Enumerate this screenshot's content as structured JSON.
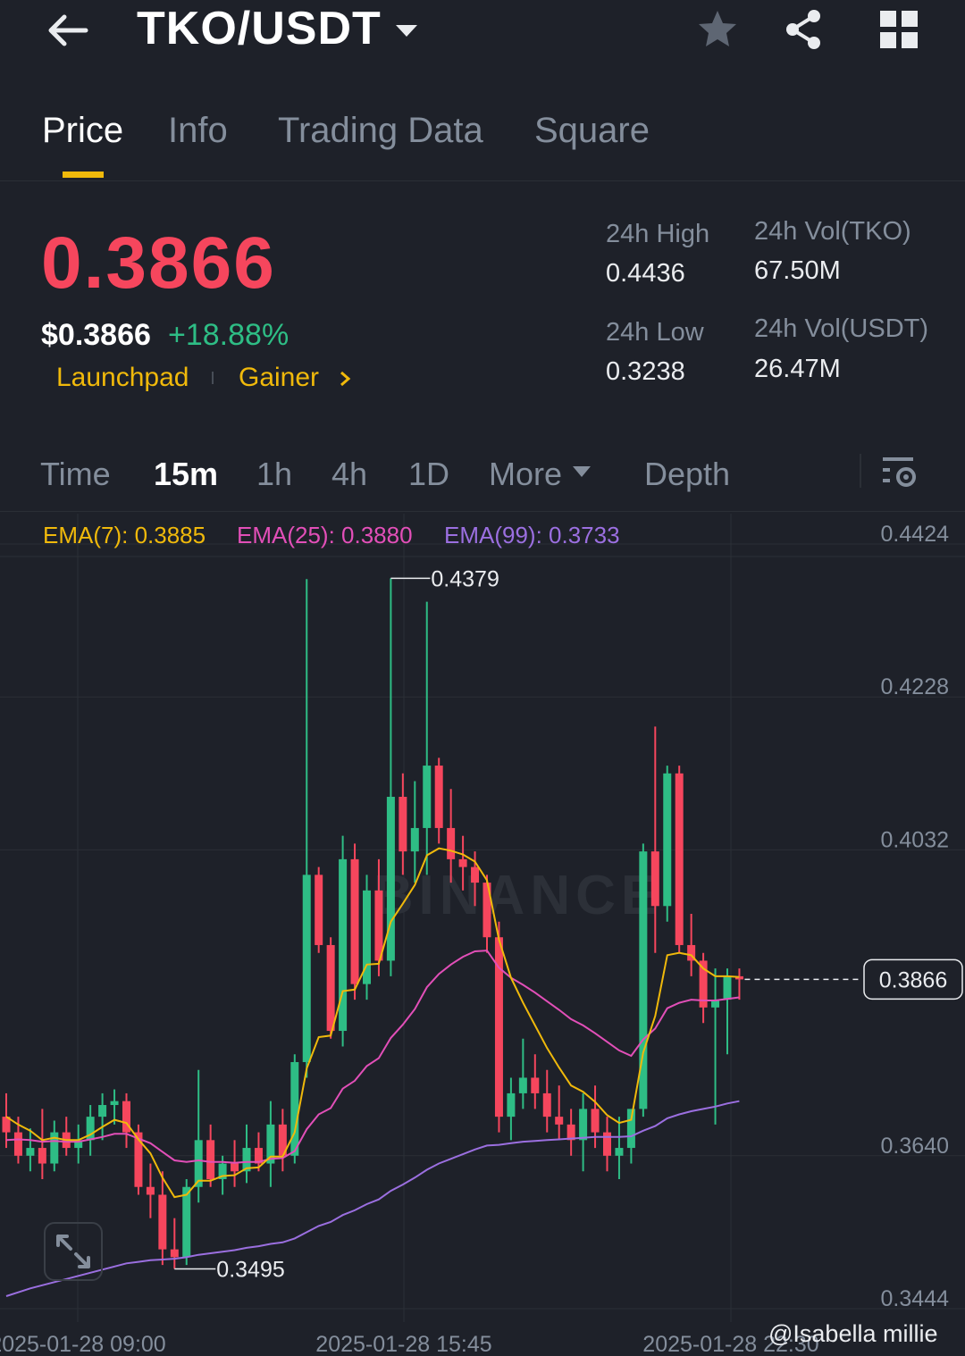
{
  "header": {
    "pair": "TKO/USDT",
    "icons": [
      "back-arrow-icon",
      "dropdown-caret-icon",
      "star-icon",
      "share-icon",
      "grid-icon"
    ]
  },
  "tabs": [
    {
      "label": "Price",
      "active": true
    },
    {
      "label": "Info",
      "active": false
    },
    {
      "label": "Trading Data",
      "active": false
    },
    {
      "label": "Square",
      "active": false
    }
  ],
  "ticker": {
    "last_price": "0.3866",
    "usd_price": "$0.3866",
    "change_pct": "+18.88%",
    "tags": [
      "Launchpad",
      "Gainer"
    ],
    "stats": {
      "high_label": "24h High",
      "high": "0.4436",
      "low_label": "24h Low",
      "low": "0.3238",
      "vol_base_label": "24h Vol(TKO)",
      "vol_base": "67.50M",
      "vol_quote_label": "24h Vol(USDT)",
      "vol_quote": "26.47M"
    }
  },
  "intervals": {
    "items": [
      "Time",
      "15m",
      "1h",
      "4h",
      "1D",
      "More",
      "Depth"
    ],
    "active": "15m"
  },
  "indicators": {
    "ema7": "EMA(7): 0.3885",
    "ema25": "EMA(25): 0.3880",
    "ema99": "EMA(99): 0.3733"
  },
  "colors": {
    "up": "#2ebd85",
    "down": "#f6465d",
    "accent": "#f0b90b",
    "ema7": "#f0b90b",
    "ema25": "#e24fb8",
    "ema99": "#9b6fe0"
  },
  "chart_data": {
    "type": "candlestick",
    "y_ticks": [
      "0.4424",
      "0.4228",
      "0.4032",
      "0.3640",
      "0.3444"
    ],
    "x_ticks": [
      "2025-01-28 09:00",
      "2025-01-28 15:45",
      "2025-01-28 22:30"
    ],
    "current_price_label": "0.3866",
    "max_label": "0.4379",
    "min_label": "0.3495",
    "ylim": [
      0.3444,
      0.4424
    ],
    "watermark": "BINANCE",
    "candles": [
      [
        0.369,
        0.372,
        0.365,
        0.367
      ],
      [
        0.367,
        0.369,
        0.363,
        0.364
      ],
      [
        0.364,
        0.3675,
        0.362,
        0.365
      ],
      [
        0.365,
        0.37,
        0.361,
        0.363
      ],
      [
        0.363,
        0.3685,
        0.362,
        0.367
      ],
      [
        0.367,
        0.369,
        0.364,
        0.365
      ],
      [
        0.365,
        0.368,
        0.363,
        0.366
      ],
      [
        0.366,
        0.3705,
        0.364,
        0.369
      ],
      [
        0.369,
        0.372,
        0.366,
        0.3705
      ],
      [
        0.3705,
        0.3725,
        0.368,
        0.371
      ],
      [
        0.371,
        0.372,
        0.365,
        0.367
      ],
      [
        0.367,
        0.368,
        0.359,
        0.36
      ],
      [
        0.36,
        0.363,
        0.356,
        0.359
      ],
      [
        0.359,
        0.362,
        0.35,
        0.352
      ],
      [
        0.352,
        0.356,
        0.3495,
        0.351
      ],
      [
        0.351,
        0.361,
        0.35,
        0.36
      ],
      [
        0.36,
        0.375,
        0.358,
        0.366
      ],
      [
        0.366,
        0.368,
        0.36,
        0.361
      ],
      [
        0.361,
        0.364,
        0.359,
        0.363
      ],
      [
        0.363,
        0.366,
        0.36,
        0.362
      ],
      [
        0.362,
        0.368,
        0.3605,
        0.365
      ],
      [
        0.365,
        0.367,
        0.362,
        0.363
      ],
      [
        0.363,
        0.371,
        0.36,
        0.368
      ],
      [
        0.368,
        0.37,
        0.362,
        0.364
      ],
      [
        0.364,
        0.377,
        0.363,
        0.376
      ],
      [
        0.376,
        0.4379,
        0.374,
        0.4
      ],
      [
        0.4,
        0.401,
        0.39,
        0.391
      ],
      [
        0.391,
        0.392,
        0.379,
        0.38
      ],
      [
        0.38,
        0.405,
        0.378,
        0.402
      ],
      [
        0.402,
        0.404,
        0.384,
        0.386
      ],
      [
        0.386,
        0.4,
        0.384,
        0.398
      ],
      [
        0.398,
        0.402,
        0.387,
        0.389
      ],
      [
        0.389,
        0.438,
        0.387,
        0.41
      ],
      [
        0.41,
        0.413,
        0.4,
        0.403
      ],
      [
        0.403,
        0.412,
        0.399,
        0.406
      ],
      [
        0.406,
        0.435,
        0.4,
        0.414
      ],
      [
        0.414,
        0.415,
        0.404,
        0.406
      ],
      [
        0.406,
        0.411,
        0.399,
        0.402
      ],
      [
        0.402,
        0.405,
        0.398,
        0.401
      ],
      [
        0.401,
        0.403,
        0.396,
        0.399
      ],
      [
        0.399,
        0.4,
        0.39,
        0.392
      ],
      [
        0.392,
        0.394,
        0.367,
        0.369
      ],
      [
        0.369,
        0.374,
        0.366,
        0.372
      ],
      [
        0.372,
        0.379,
        0.37,
        0.374
      ],
      [
        0.374,
        0.377,
        0.37,
        0.372
      ],
      [
        0.372,
        0.375,
        0.367,
        0.369
      ],
      [
        0.369,
        0.373,
        0.366,
        0.368
      ],
      [
        0.368,
        0.37,
        0.364,
        0.366
      ],
      [
        0.366,
        0.372,
        0.362,
        0.37
      ],
      [
        0.37,
        0.373,
        0.365,
        0.367
      ],
      [
        0.367,
        0.369,
        0.362,
        0.364
      ],
      [
        0.364,
        0.369,
        0.361,
        0.365
      ],
      [
        0.365,
        0.368,
        0.363,
        0.37
      ],
      [
        0.37,
        0.404,
        0.369,
        0.403
      ],
      [
        0.403,
        0.419,
        0.39,
        0.396
      ],
      [
        0.396,
        0.414,
        0.394,
        0.413
      ],
      [
        0.413,
        0.414,
        0.39,
        0.391
      ],
      [
        0.391,
        0.395,
        0.387,
        0.389
      ],
      [
        0.389,
        0.39,
        0.381,
        0.383
      ],
      [
        0.383,
        0.388,
        0.368,
        0.384
      ],
      [
        0.384,
        0.388,
        0.377,
        0.387
      ],
      [
        0.387,
        0.388,
        0.384,
        0.3866
      ]
    ],
    "ema7": [
      0.369,
      0.368,
      0.3672,
      0.366,
      0.3663,
      0.366,
      0.366,
      0.3667,
      0.3677,
      0.3686,
      0.3682,
      0.3661,
      0.3643,
      0.3612,
      0.3587,
      0.359,
      0.3608,
      0.3608,
      0.3614,
      0.3615,
      0.3624,
      0.3625,
      0.3639,
      0.3639,
      0.367,
      0.3752,
      0.3792,
      0.3794,
      0.3851,
      0.3853,
      0.3885,
      0.3886,
      0.394,
      0.3963,
      0.3987,
      0.4025,
      0.4034,
      0.4031,
      0.4026,
      0.4017,
      0.3993,
      0.3917,
      0.3868,
      0.3836,
      0.3807,
      0.3778,
      0.3753,
      0.373,
      0.3722,
      0.3709,
      0.3692,
      0.3682,
      0.3686,
      0.3772,
      0.3819,
      0.3897,
      0.39,
      0.3897,
      0.388,
      0.387,
      0.387,
      0.3869
    ],
    "ema25": [
      0.366,
      0.3661,
      0.366,
      0.3658,
      0.3659,
      0.3658,
      0.3658,
      0.3661,
      0.3664,
      0.3668,
      0.3668,
      0.3662,
      0.3656,
      0.3645,
      0.3634,
      0.3632,
      0.3634,
      0.3632,
      0.3632,
      0.3631,
      0.3632,
      0.3632,
      0.3636,
      0.3637,
      0.3646,
      0.3674,
      0.3693,
      0.3701,
      0.3726,
      0.3736,
      0.3755,
      0.3765,
      0.3791,
      0.3808,
      0.3828,
      0.3856,
      0.3873,
      0.3885,
      0.3895,
      0.3902,
      0.3903,
      0.3881,
      0.3868,
      0.3859,
      0.3849,
      0.3838,
      0.3827,
      0.3815,
      0.3807,
      0.3797,
      0.3786,
      0.3775,
      0.3768,
      0.3789,
      0.3803,
      0.3829,
      0.3836,
      0.384,
      0.3839,
      0.3839,
      0.3841,
      0.3843
    ],
    "ema99": [
      0.346,
      0.3465,
      0.347,
      0.3474,
      0.3478,
      0.3482,
      0.3486,
      0.349,
      0.3494,
      0.3498,
      0.3502,
      0.3504,
      0.3506,
      0.3507,
      0.3508,
      0.351,
      0.3513,
      0.3515,
      0.3517,
      0.3519,
      0.3522,
      0.3524,
      0.3527,
      0.3529,
      0.3534,
      0.3542,
      0.355,
      0.3555,
      0.3564,
      0.357,
      0.3578,
      0.3584,
      0.3595,
      0.3603,
      0.3612,
      0.3622,
      0.363,
      0.3636,
      0.3642,
      0.3648,
      0.3653,
      0.3654,
      0.3656,
      0.3658,
      0.3659,
      0.366,
      0.3661,
      0.3662,
      0.3663,
      0.3664,
      0.3664,
      0.3664,
      0.3665,
      0.3672,
      0.3678,
      0.3688,
      0.3693,
      0.3697,
      0.37,
      0.3703,
      0.3707,
      0.371
    ]
  },
  "watermark_user": "@Isabella millie"
}
